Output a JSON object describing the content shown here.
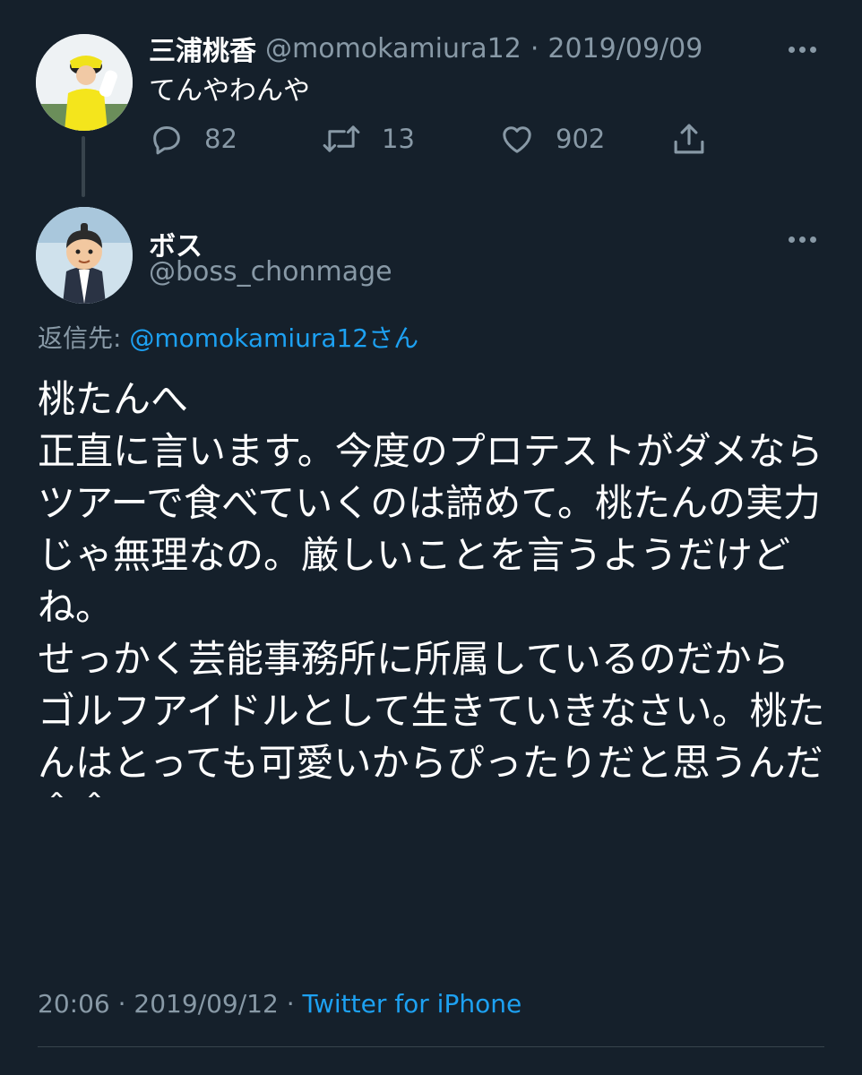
{
  "tweet1": {
    "display_name": "三浦桃香",
    "handle": "@momokamiura12",
    "separator": "·",
    "date": "2019/09/09",
    "text": "てんやわんや",
    "actions": {
      "reply_count": "82",
      "retweet_count": "13",
      "like_count": "902"
    }
  },
  "tweet2": {
    "display_name": "ボス",
    "handle": "@boss_chonmage",
    "reply_to_label": "返信先:",
    "reply_to_handle": "@momokamiura12",
    "reply_to_suffix": "さん",
    "body": "桃たんへ\n正直に言います。今度のプロテストがダメならツアーで食べていくのは諦めて。桃たんの実力じゃ無理なの。厳しいことを言うようだけどね。\nせっかく芸能事務所に所属しているのだからゴルフアイドルとして生きていきなさい。桃たんはとっても可愛いからぴったりだと思うんだ＾＾",
    "time": "20:06",
    "separator": "·",
    "date": "2019/09/12",
    "separator2": "·",
    "source": "Twitter for iPhone"
  },
  "icons": {
    "reply": "reply-icon",
    "retweet": "retweet-icon",
    "like": "like-icon",
    "share": "share-icon",
    "more": "more-icon"
  },
  "colors": {
    "background": "#15202b",
    "text": "#ffffff",
    "muted": "#8899a6",
    "link": "#1da1f2",
    "divider": "#38444d"
  }
}
